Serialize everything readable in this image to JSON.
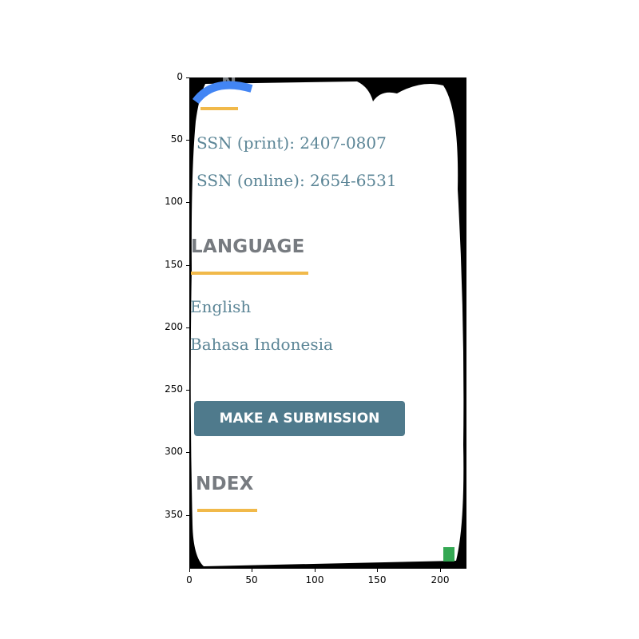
{
  "partial_heading": {
    "label": "N"
  },
  "issn": {
    "print": "SSN (print): 2407-0807",
    "online": "SSN (online): 2654-6531"
  },
  "language": {
    "title": "LANGUAGE",
    "options": [
      "English",
      "Bahasa Indonesia"
    ]
  },
  "submission": {
    "button_label": "MAKE A SUBMISSION"
  },
  "index": {
    "title": "NDEX"
  },
  "axes": {
    "y_ticks": [
      "0",
      "50",
      "100",
      "150",
      "200",
      "250",
      "300",
      "350"
    ],
    "x_ticks": [
      "0",
      "50",
      "100",
      "150",
      "200"
    ]
  },
  "colors": {
    "heading_text": "#777b80",
    "underline_accent": "#f1b94a",
    "link_text": "#5b8596",
    "button_bg": "#4f7a8c",
    "google_blue": "#4285f4",
    "google_green": "#34a853"
  },
  "icons": [
    "google-g-logo-icon"
  ]
}
